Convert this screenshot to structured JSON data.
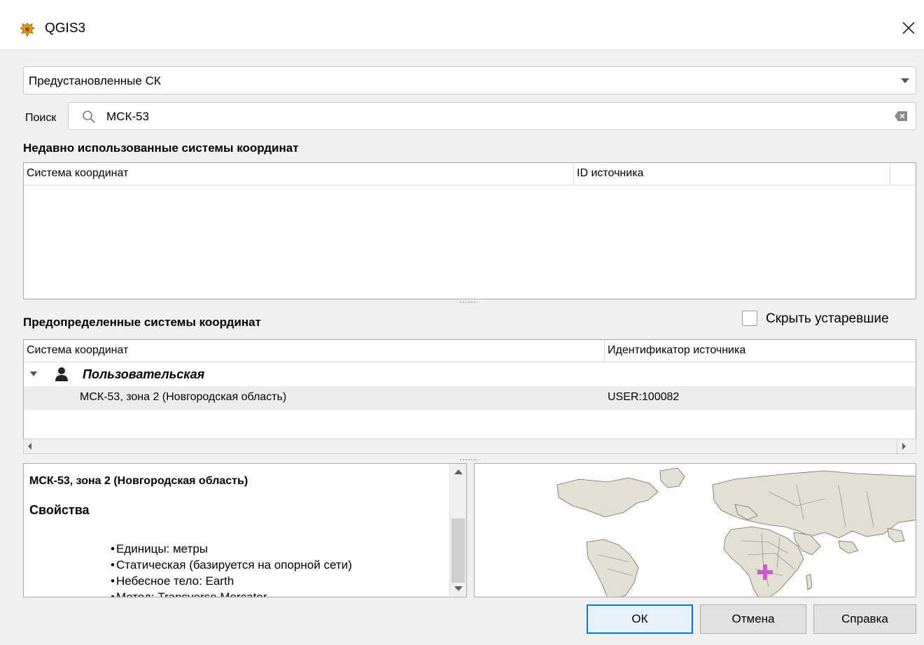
{
  "window": {
    "title": "QGIS3",
    "app_icon": "coat-of-arms-icon",
    "close_icon": "close-icon"
  },
  "crs_type_combo": {
    "value": "Предустановленные СК"
  },
  "search": {
    "label": "Поиск",
    "value": "МСК-53"
  },
  "recent": {
    "title": "Недавно использованные системы координат",
    "columns": [
      "Система координат",
      "ID источника"
    ]
  },
  "predefined": {
    "title": "Предопределенные системы координат",
    "hide_deprecated_label": "Скрыть устаревшие",
    "hide_deprecated_checked": false,
    "columns": [
      "Система координат",
      "Идентификатор источника"
    ],
    "group": {
      "name": "Пользовательская",
      "expanded": true
    },
    "rows": [
      {
        "name": "МСК-53, зона 2 (Новгородская область)",
        "id": "USER:100082",
        "selected": true
      }
    ]
  },
  "info": {
    "crs_name": "МСК-53, зона 2 (Новгородская область)",
    "properties_title": "Свойства",
    "properties": [
      "Единицы: метры",
      "Статическая (базируется на опорной сети)",
      "Небесное тело: Earth",
      "Метод: Transverse Mercator"
    ]
  },
  "buttons": {
    "ok": "ОК",
    "cancel": "Отмена",
    "help": "Справка"
  },
  "colors": {
    "accent": "#0078d7",
    "marker": "#c85ccb",
    "land": "#e3dfd2",
    "selected_row": "#ececec"
  }
}
